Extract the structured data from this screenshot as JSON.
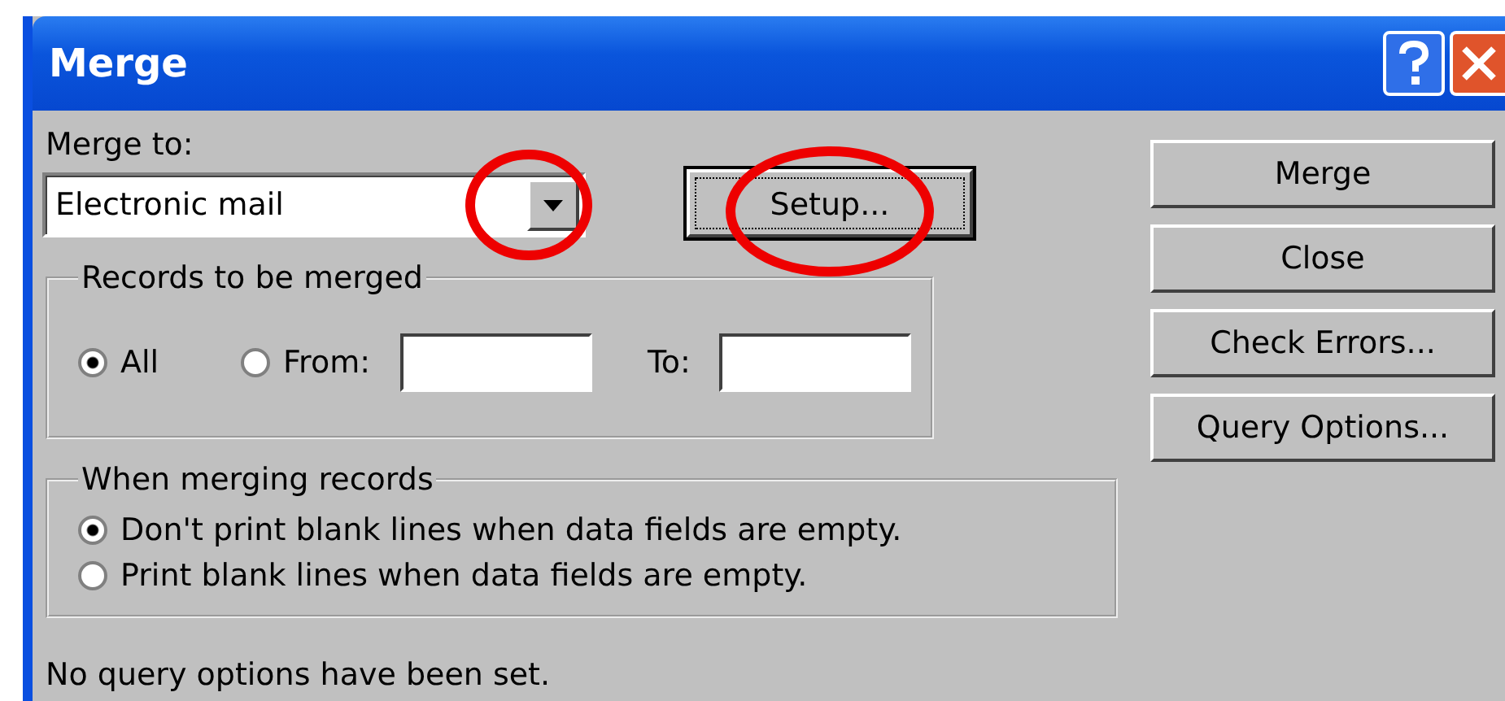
{
  "window": {
    "title": "Merge"
  },
  "merge_to": {
    "label": "Merge to:",
    "value": "Electronic mail",
    "highlighted": true
  },
  "setup_button": {
    "label": "Setup...",
    "highlighted": true
  },
  "records_group": {
    "title": "Records to be merged",
    "options": [
      {
        "label": "All",
        "selected": true
      },
      {
        "label": "From:",
        "selected": false
      }
    ],
    "to_label": "To:"
  },
  "merging_group": {
    "title": "When merging records",
    "options": [
      {
        "label": "Don't print blank lines when data fields are empty.",
        "selected": true
      },
      {
        "label": "Print blank lines when data fields are empty.",
        "selected": false
      }
    ]
  },
  "status": "No query options have been set.",
  "buttons": [
    "Merge",
    "Close",
    "Check Errors...",
    "Query Options..."
  ]
}
